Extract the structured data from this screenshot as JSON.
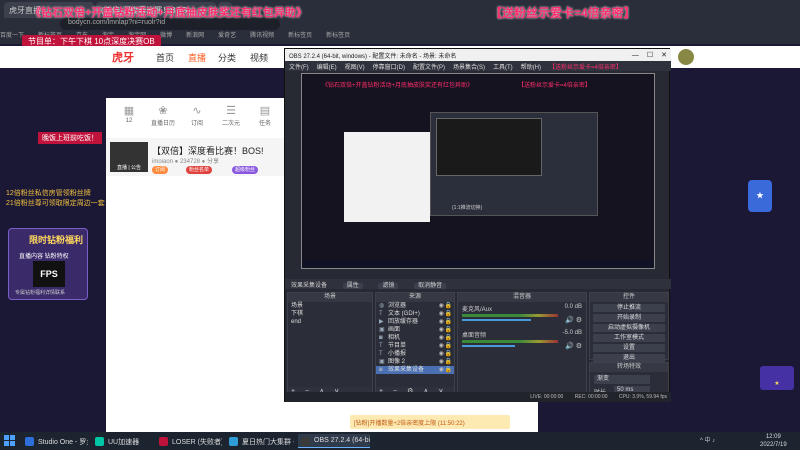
{
  "overlay": {
    "title_left": "《钻石双倍+开盖钻粉活动+月底抽皮肤奖还有红包异助》",
    "title_right": "【送粉丝示爱卡=4倍亲密】",
    "subtitle": "节目单：下午下棋 10点深度决赛OB",
    "promo_a": "晚饭上班前吃饭！",
    "promo_b": "12倍粉丝私信房管领粉丝牌",
    "promo_c": "21倍粉丝尊可领取限定周边一套",
    "card_title": "限时钻粉福利",
    "card_sub": "直播内容  钻粉特权",
    "card_logo": "FPS",
    "card_note": "专属钻粉福利详情联系"
  },
  "browser": {
    "tabs": [
      "虎牙直播",
      "(双倍)深度看比赛！BOS!",
      "+"
    ],
    "address": "bodycn.com/lmnlap?ni=ruolr?id",
    "bookmarks": [
      "百度一下",
      "新标签页",
      "京东",
      "淘宝",
      "淘宝网",
      "微博",
      "新浪网",
      "爱奇艺",
      "腾讯视频",
      "新标签页",
      "新标签页"
    ]
  },
  "site": {
    "logo": "虎牙",
    "nav": [
      "首页",
      "直播",
      "分类",
      "视频"
    ],
    "active_nav": "直播",
    "categories": [
      {
        "label": "12",
        "icon": "calendar-icon"
      },
      {
        "label": "直播日历",
        "icon": "fan-icon"
      },
      {
        "label": "订阅",
        "icon": "wave-icon"
      },
      {
        "label": "二次元",
        "icon": "list-icon"
      },
      {
        "label": "任务",
        "icon": "grid-icon"
      }
    ],
    "room_title": "【双倍】深度看比赛！BOS!",
    "room_meta": "imoiaon  ● 234728   ● 分享",
    "room_thumb_label": "直播 | 公告",
    "pills": [
      "订阅",
      "粉丝名单",
      "超级粉丝"
    ],
    "bottom_notice": "[钻粉]开播数量+2倍亲密度上限 (11:50:22)"
  },
  "obs": {
    "title": "OBS 27.2.4 (64-bit, windows) - 配置文件: 未命名 - 场景: 未命名",
    "menu": [
      "文件(F)",
      "编辑(E)",
      "视图(V)",
      "停靠窗口(D)",
      "配置文件(P)",
      "场景集合(S)",
      "工具(T)",
      "帮助(H)"
    ],
    "menu_overlay": "【送粉丝示爱卡=4倍亲密】",
    "preview_note": "(1:1推流切换)",
    "tabrow": [
      "效果采集设备",
      "属性",
      "滤镜",
      "取消静音"
    ],
    "scenes_header": "场景",
    "scenes": [
      "场景",
      "下棋",
      "end"
    ],
    "sources_header": "来源",
    "sources": [
      {
        "name": "浏览器",
        "icon": "globe-icon"
      },
      {
        "name": "文本 (GDI+)",
        "icon": "text-icon"
      },
      {
        "name": "回放缓存器",
        "icon": "film-icon"
      },
      {
        "name": "画面",
        "icon": "image-icon"
      },
      {
        "name": "相机",
        "icon": "camera-icon"
      },
      {
        "name": "节目单",
        "icon": "text-icon"
      },
      {
        "name": "小播报",
        "icon": "text-icon"
      },
      {
        "name": "图像 2",
        "icon": "image-icon"
      },
      {
        "name": "效果采集设备",
        "icon": "camera-icon"
      }
    ],
    "selected_source": "效果采集设备",
    "mixer_header": "混音器",
    "mixer": [
      {
        "name": "麦克风/Aux",
        "db": "0.0 dB",
        "level": 0.72
      },
      {
        "name": "桌面音频",
        "db": "-5.0 dB",
        "level": 0.55
      }
    ],
    "controls_header": "控件",
    "controls": [
      "停止推流",
      "开始录制",
      "启动虚拟摄像机",
      "工作室模式",
      "设置",
      "退出"
    ],
    "transitions_header": "转场特效",
    "transition": "渐变",
    "duration_label": "时长",
    "duration": "50 ms",
    "status": [
      "LIVE: 00:00:00",
      "REC: 00:00:00",
      "CPU: 3.9%, 59.94 fps"
    ]
  },
  "taskbar": {
    "items": [
      {
        "label": "Studio One - 罗兰...",
        "color": "#2e6edb"
      },
      {
        "label": "UU加速器",
        "color": "#00c6a6"
      },
      {
        "label": "LOSER (失败者) -...",
        "color": "#c0133b"
      },
      {
        "label": "夏日热门大集群 -...",
        "color": "#2f9cd8"
      },
      {
        "label": "OBS 27.2.4 (64-bi...",
        "color": "#3a3a3a"
      }
    ],
    "active": "OBS 27.2.4 (64-bi...",
    "tray": "^ 中 ♪",
    "time": "12:09",
    "date": "2022/7/19"
  }
}
